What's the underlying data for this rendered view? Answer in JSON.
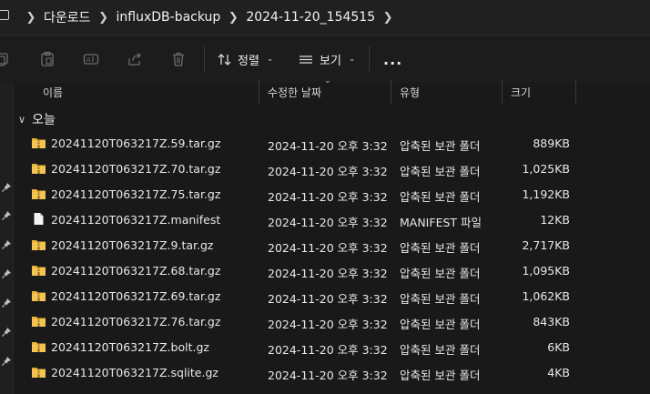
{
  "breadcrumb": {
    "items": [
      "다운로드",
      "influxDB-backup",
      "2024-11-20_154515"
    ]
  },
  "toolbar": {
    "sort_label": "정렬",
    "view_label": "보기",
    "more_label": "..."
  },
  "columns": {
    "name": "이름",
    "modified": "수정한 날짜",
    "type": "유형",
    "size": "크기"
  },
  "group": {
    "label": "오늘"
  },
  "files": [
    {
      "name": "20241120T063217Z.59.tar.gz",
      "modified": "2024-11-20 오후 3:32",
      "type": "압축된 보관 폴더",
      "size": "889KB",
      "icon": "zip-folder-icon"
    },
    {
      "name": "20241120T063217Z.70.tar.gz",
      "modified": "2024-11-20 오후 3:32",
      "type": "압축된 보관 폴더",
      "size": "1,025KB",
      "icon": "zip-folder-icon"
    },
    {
      "name": "20241120T063217Z.75.tar.gz",
      "modified": "2024-11-20 오후 3:32",
      "type": "압축된 보관 폴더",
      "size": "1,192KB",
      "icon": "zip-folder-icon"
    },
    {
      "name": "20241120T063217Z.manifest",
      "modified": "2024-11-20 오후 3:32",
      "type": "MANIFEST 파일",
      "size": "12KB",
      "icon": "file-icon"
    },
    {
      "name": "20241120T063217Z.9.tar.gz",
      "modified": "2024-11-20 오후 3:32",
      "type": "압축된 보관 폴더",
      "size": "2,717KB",
      "icon": "zip-folder-icon"
    },
    {
      "name": "20241120T063217Z.68.tar.gz",
      "modified": "2024-11-20 오후 3:32",
      "type": "압축된 보관 폴더",
      "size": "1,095KB",
      "icon": "zip-folder-icon"
    },
    {
      "name": "20241120T063217Z.69.tar.gz",
      "modified": "2024-11-20 오후 3:32",
      "type": "압축된 보관 폴더",
      "size": "1,062KB",
      "icon": "zip-folder-icon"
    },
    {
      "name": "20241120T063217Z.76.tar.gz",
      "modified": "2024-11-20 오후 3:32",
      "type": "압축된 보관 폴더",
      "size": "843KB",
      "icon": "zip-folder-icon"
    },
    {
      "name": "20241120T063217Z.bolt.gz",
      "modified": "2024-11-20 오후 3:32",
      "type": "압축된 보관 폴더",
      "size": "6KB",
      "icon": "zip-folder-icon"
    },
    {
      "name": "20241120T063217Z.sqlite.gz",
      "modified": "2024-11-20 오후 3:32",
      "type": "압축된 보관 폴더",
      "size": "4KB",
      "icon": "zip-folder-icon"
    }
  ],
  "colors": {
    "background": "#191919",
    "folder": "#e8b437",
    "text": "#e6e6e6"
  }
}
